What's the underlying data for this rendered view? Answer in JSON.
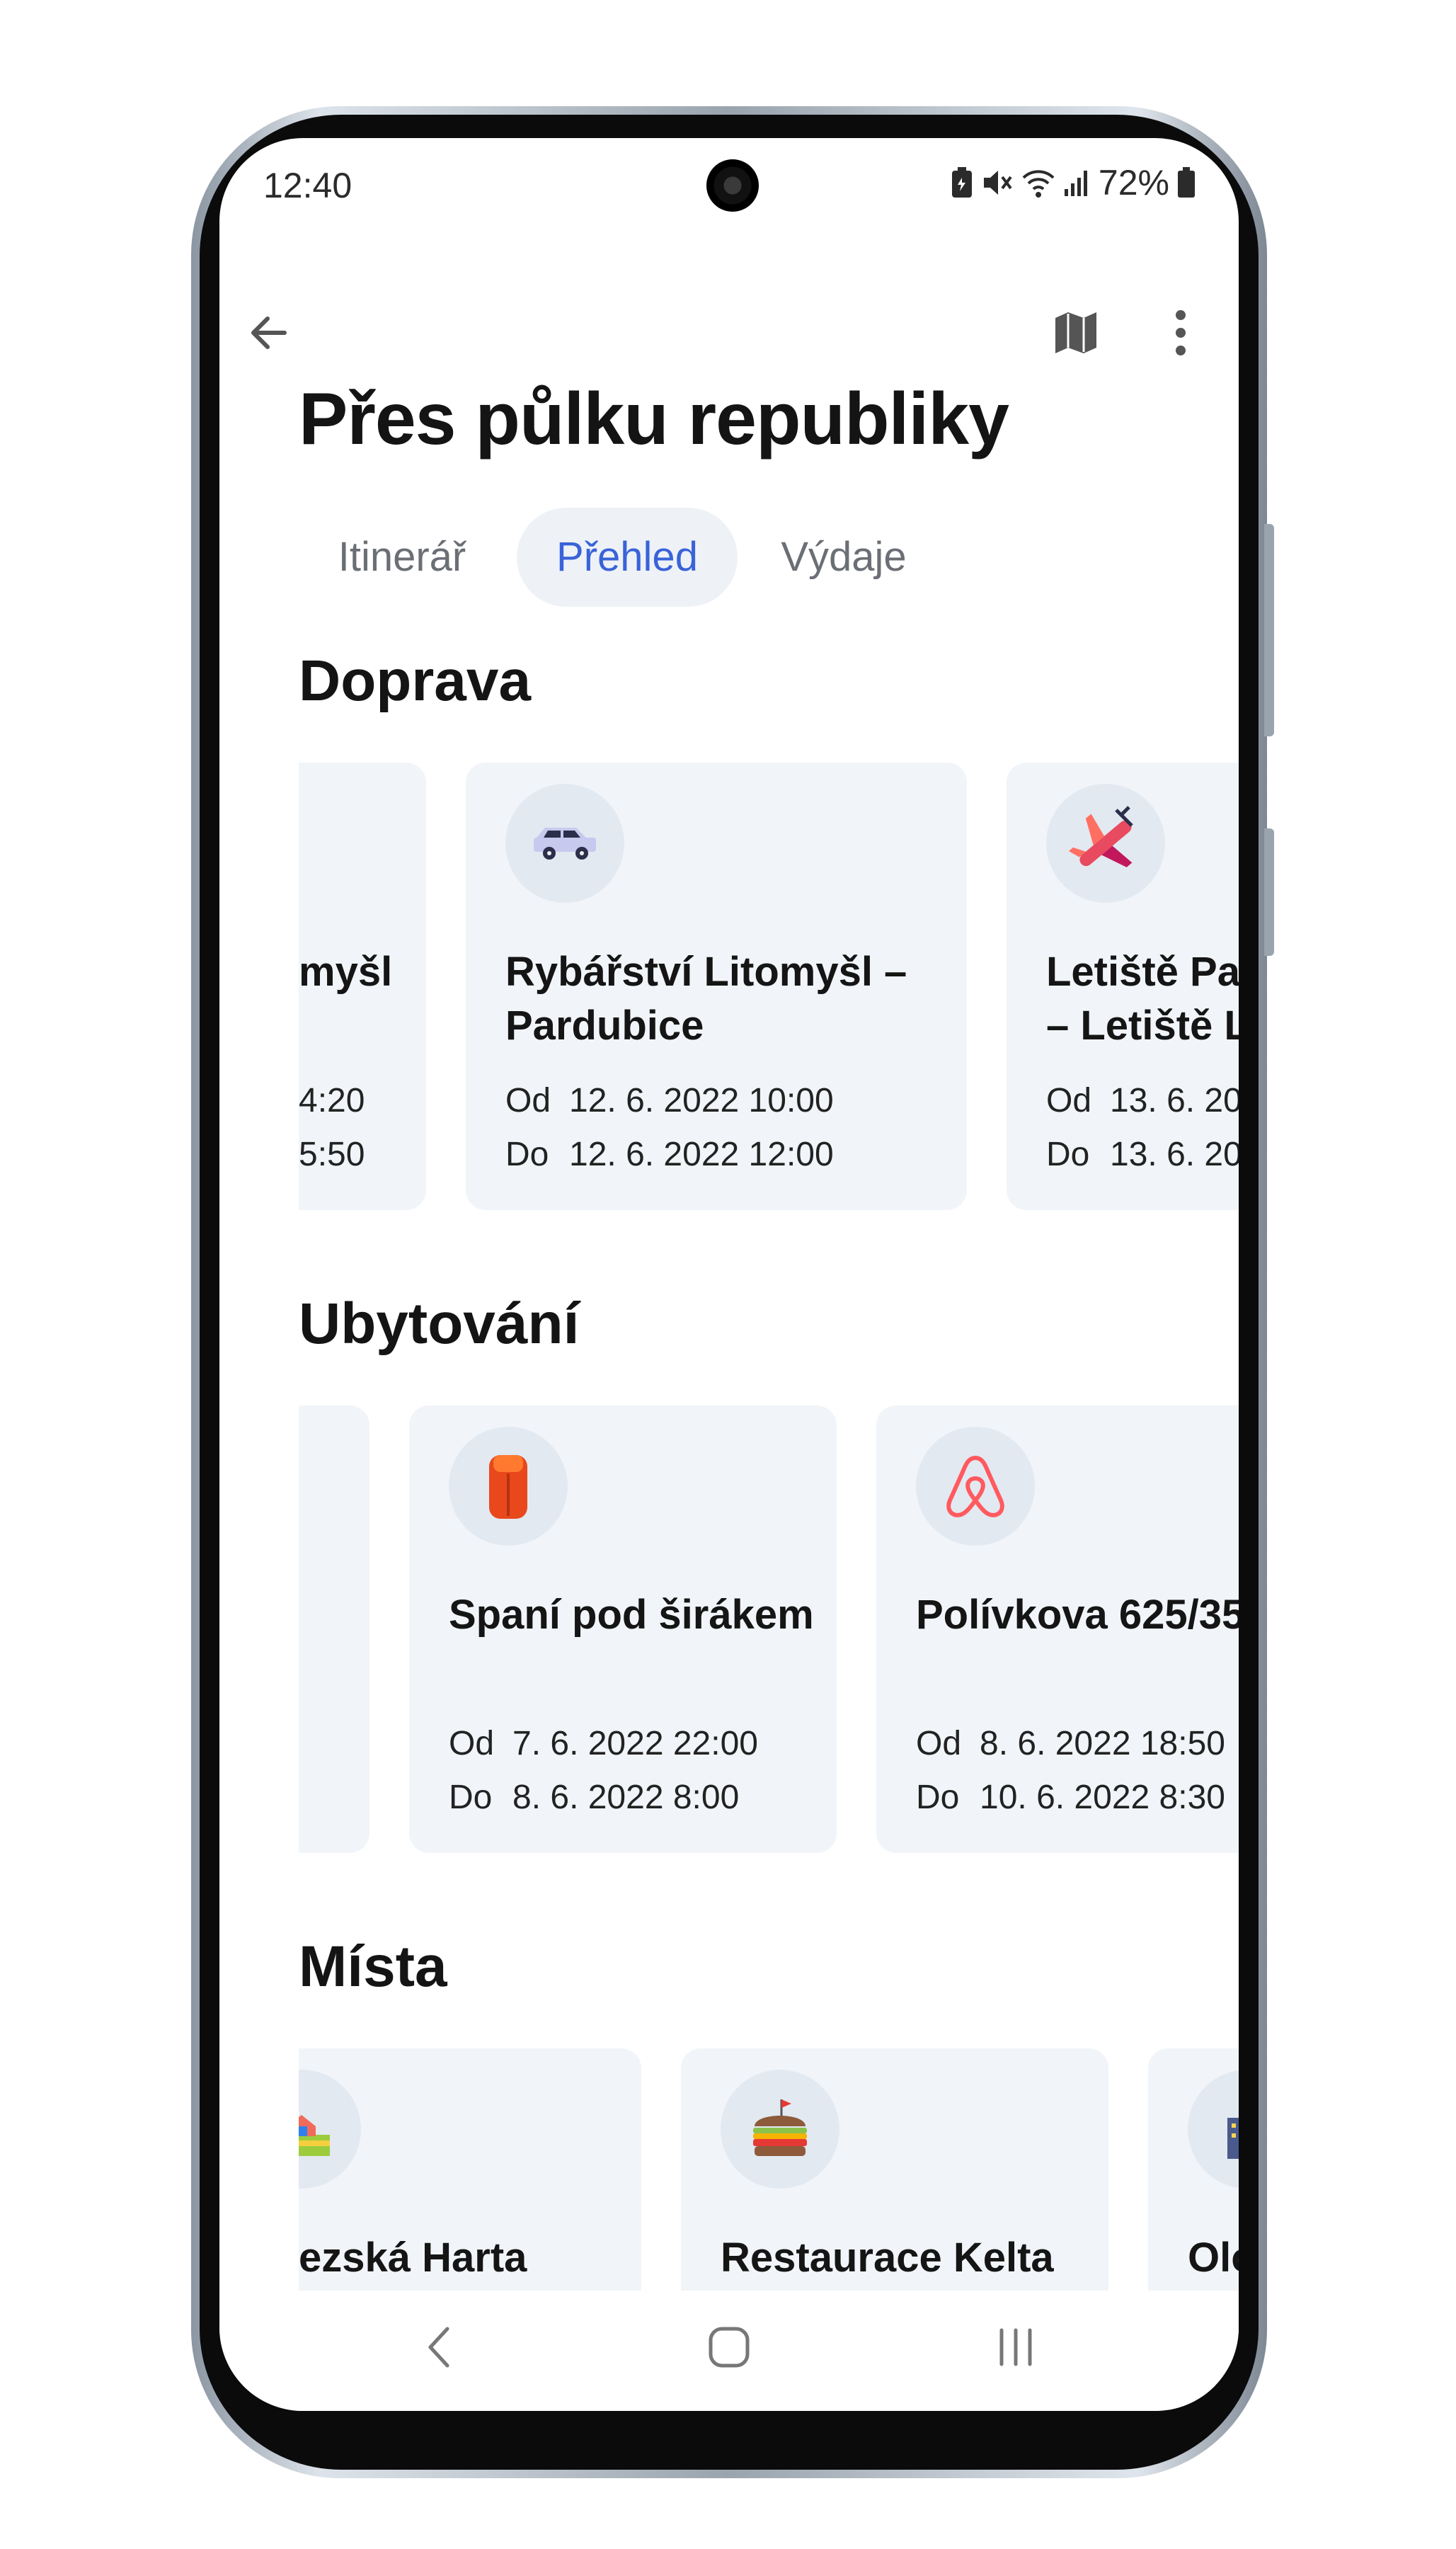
{
  "status_bar": {
    "time": "12:40",
    "battery": "72%"
  },
  "app_bar": {
    "back_icon": "arrow-left-icon",
    "map_icon": "map-icon",
    "menu_icon": "more-vert-icon"
  },
  "title": "Přes půlku republiky",
  "tabs": [
    {
      "label": "Itinerář",
      "active": false
    },
    {
      "label": "Přehled",
      "active": true
    },
    {
      "label": "Výdaje",
      "active": false
    }
  ],
  "sections": {
    "doprava": {
      "title": "Doprava",
      "cards": [
        {
          "title_line1": "myšl",
          "title_line2": "",
          "from_label": "",
          "from": "4:20",
          "to_label": "",
          "to": "5:50"
        },
        {
          "icon": "car-icon",
          "title_line1": "Rybářství Litomyšl –",
          "title_line2": "Pardubice",
          "from_label": "Od",
          "from": "12. 6. 2022 10:00",
          "to_label": "Do",
          "to": "12. 6. 2022 12:00"
        },
        {
          "icon": "airplane-icon",
          "title_line1": "Letiště Pard",
          "title_line2": "– Letiště Lo",
          "from_label": "Od",
          "from": "13. 6. 20",
          "to_label": "Do",
          "to": "13. 6. 20"
        }
      ]
    },
    "ubytovani": {
      "title": "Ubytování",
      "cards": [
        {},
        {
          "icon": "sleeping-bag-icon",
          "title": "Spaní pod širákem",
          "from_label": "Od",
          "from": "7. 6. 2022 22:00",
          "to_label": "Do",
          "to": "8. 6. 2022 8:00"
        },
        {
          "icon": "airbnb-icon",
          "title": "Polívkova 625/35",
          "from_label": "Od",
          "from": "8. 6. 2022 18:50",
          "to_label": "Do",
          "to": "10. 6. 2022 8:30"
        }
      ]
    },
    "mista": {
      "title": "Místa",
      "cards": [
        {
          "icon": "park-icon",
          "title": "ezská Harta"
        },
        {
          "icon": "burger-icon",
          "title": "Restaurace Kelta"
        },
        {
          "icon": "city-building-icon",
          "title": "Olo"
        }
      ]
    }
  },
  "nav_bar": {
    "back": "nav-back-icon",
    "home": "nav-home-icon",
    "recents": "nav-recents-icon"
  },
  "colors": {
    "accent": "#3a63d8",
    "card_bg": "#f1f5f9",
    "tab_active_bg": "#eef2f7"
  }
}
